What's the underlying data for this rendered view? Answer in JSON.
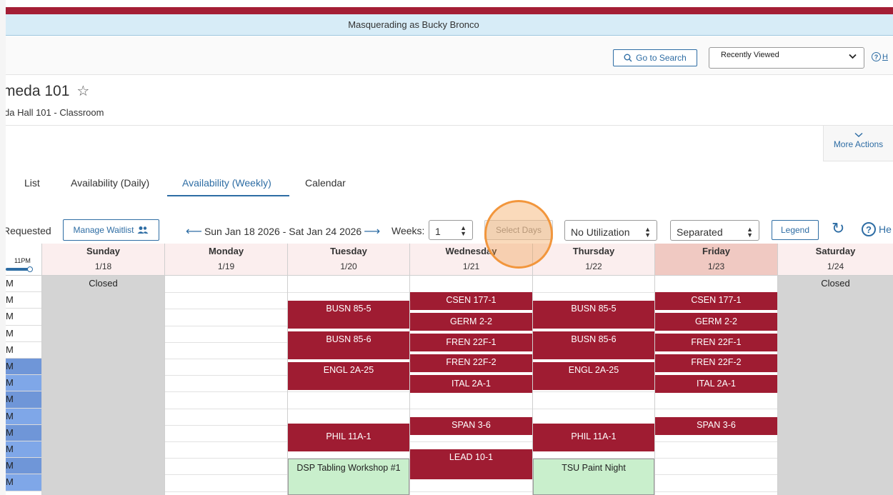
{
  "banner": {
    "text": "Masquerading as Bucky Bronco"
  },
  "header": {
    "go_to_search": "Go to Search",
    "recent": "Recently Viewed",
    "help": "H"
  },
  "room": {
    "title": "meda 101",
    "subtitle": "da Hall 101 - Classroom"
  },
  "more_actions": "More Actions",
  "tabs": [
    {
      "label": "List"
    },
    {
      "label": "Availability (Daily)"
    },
    {
      "label": "Availability (Weekly)"
    },
    {
      "label": "Calendar"
    }
  ],
  "toolbar": {
    "requested": "Requested",
    "manage_waitlist": "Manage Waitlist",
    "date_range": "Sun Jan 18 2026 - Sat Jan 24 2026",
    "weeks_label": "Weeks:",
    "weeks_value": "1",
    "select_days": "Select Days",
    "utilization": "No Utilization",
    "view_mode": "Separated",
    "legend": "Legend",
    "help": "He"
  },
  "time_header": "11PM",
  "time_rows": [
    "M",
    "M",
    "M",
    "M",
    "M",
    "M",
    "M",
    "M",
    "M",
    "M",
    "M",
    "M",
    "M"
  ],
  "days": [
    {
      "name": "Sunday",
      "date": "1/18",
      "closed": "Closed"
    },
    {
      "name": "Monday",
      "date": "1/19"
    },
    {
      "name": "Tuesday",
      "date": "1/20"
    },
    {
      "name": "Wednesday",
      "date": "1/21"
    },
    {
      "name": "Thursday",
      "date": "1/22"
    },
    {
      "name": "Friday",
      "date": "1/23"
    },
    {
      "name": "Saturday",
      "date": "1/24",
      "closed": "Closed"
    }
  ],
  "events": {
    "tuesday": [
      "BUSN 85-5",
      "BUSN 85-6",
      "ENGL 2A-25",
      "PHIL 11A-1",
      "DSP Tabling Workshop #1"
    ],
    "wednesday": [
      "CSEN 177-1",
      "GERM 2-2",
      "FREN 22F-1",
      "FREN 22F-2",
      "ITAL 2A-1",
      "SPAN 3-6",
      "LEAD 10-1"
    ],
    "thursday": [
      "BUSN 85-5",
      "BUSN 85-6",
      "ENGL 2A-25",
      "PHIL 11A-1",
      "TSU Paint Night"
    ],
    "friday": [
      "CSEN 177-1",
      "GERM 2-2",
      "FREN 22F-1",
      "FREN 22F-2",
      "ITAL 2A-1",
      "SPAN 3-6"
    ]
  },
  "colors": {
    "accent": "#2e6da4",
    "event": "#9f1c32",
    "banner": "#a41e35"
  }
}
